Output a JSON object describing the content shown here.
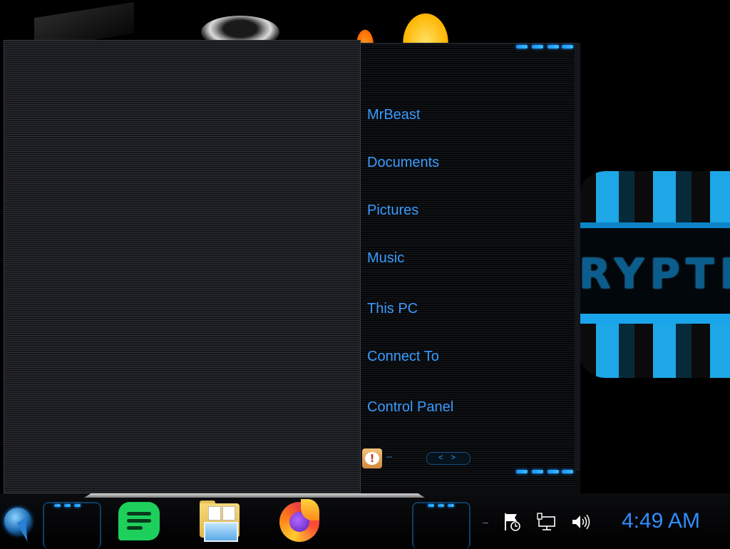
{
  "start_menu": {
    "places": [
      {
        "label": "MrBeast"
      },
      {
        "label": "Documents"
      },
      {
        "label": "Pictures"
      },
      {
        "label": "Music"
      },
      {
        "label": "This PC"
      },
      {
        "label": "Connect To"
      },
      {
        "label": "Control Panel"
      }
    ],
    "notification_text": "--",
    "nav_arrows_label": "< >"
  },
  "taskbar": {
    "start_orb_icon": "start-orb-icon",
    "pinned_apps": [
      {
        "name": "chat-app",
        "icon": "chat-bubble-icon",
        "color": "#1dd05c"
      },
      {
        "name": "file-explorer",
        "icon": "folder-icon"
      },
      {
        "name": "firefox",
        "icon": "firefox-icon"
      }
    ],
    "tray_chevron": "–",
    "tray_icons": [
      "action-center-flag-icon",
      "network-icon",
      "volume-icon"
    ],
    "clock": "4:49 AM"
  },
  "wallpaper": {
    "banner_text": "RYPTIC",
    "accent_color": "#1aa4ea"
  }
}
